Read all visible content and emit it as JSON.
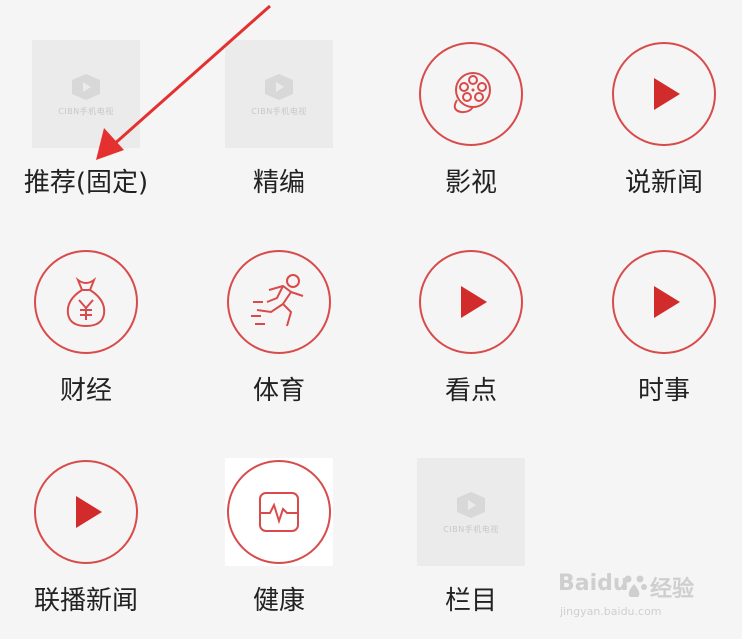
{
  "items": [
    {
      "label": "推荐(固定)",
      "icon": "placeholder-logo-icon",
      "placeholder_text": "CIBN手机电视"
    },
    {
      "label": "精编",
      "icon": "placeholder-logo-icon",
      "placeholder_text": "CIBN手机电视"
    },
    {
      "label": "影视",
      "icon": "film-reel-icon"
    },
    {
      "label": "说新闻",
      "icon": "play-icon"
    },
    {
      "label": "财经",
      "icon": "money-bag-icon"
    },
    {
      "label": "体育",
      "icon": "running-icon"
    },
    {
      "label": "看点",
      "icon": "play-icon"
    },
    {
      "label": "时事",
      "icon": "play-icon"
    },
    {
      "label": "联播新闻",
      "icon": "play-icon"
    },
    {
      "label": "健康",
      "icon": "heartbeat-icon"
    },
    {
      "label": "栏目",
      "icon": "placeholder-logo-icon",
      "placeholder_text": "CIBN手机电视"
    }
  ],
  "watermark": {
    "brand": "Baidu",
    "sub": "经验",
    "url": "jingyan.baidu.com"
  },
  "colors": {
    "accent": "#d94b4b",
    "play": "#d12b2b",
    "background": "#f5f5f5",
    "annotation_arrow": "#e53030"
  }
}
